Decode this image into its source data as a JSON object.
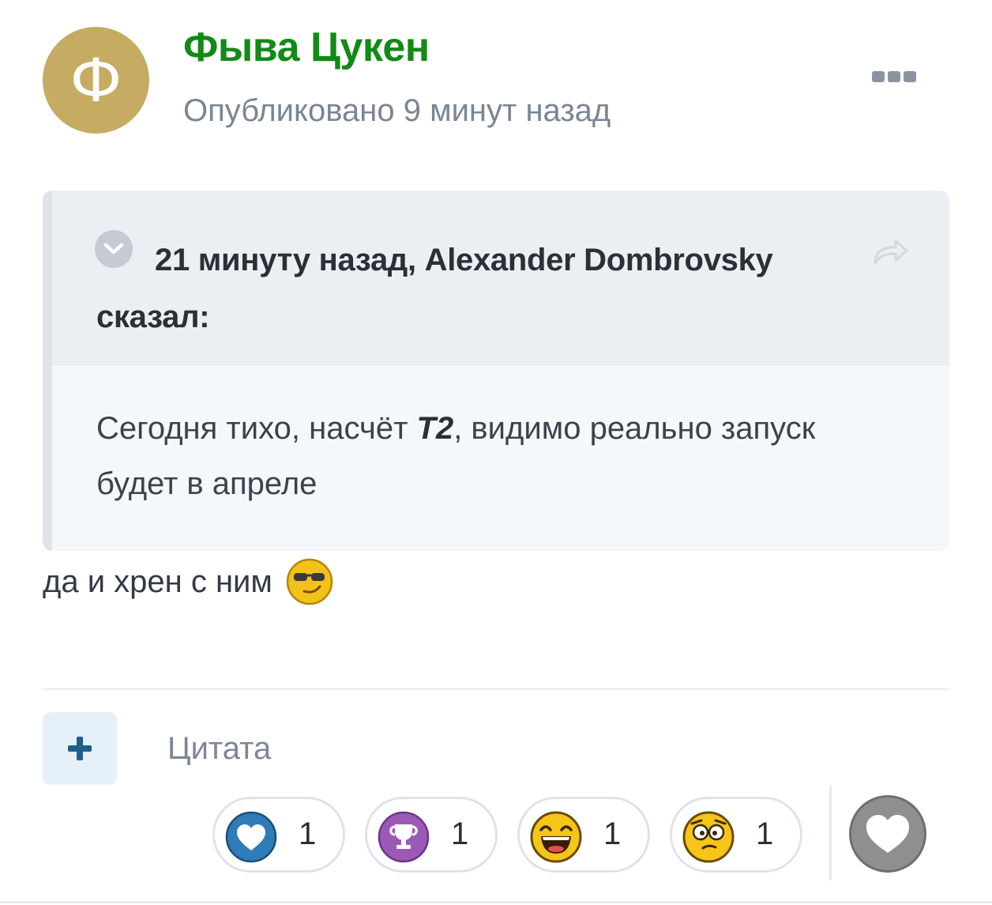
{
  "post": {
    "avatar_letter": "Ф",
    "author": "Фыва Цукен",
    "published": "Опубликовано 9 минут назад",
    "more_icon": "ellipsis-icon",
    "quote": {
      "citation": "21 минуту назад, Alexander Dombrovsky сказал:",
      "text_before": "Сегодня тихо, насчёт ",
      "text_em": "Т2",
      "text_after": ", видимо реально запуск будет в апреле"
    },
    "text": "да и хрен с ним",
    "text_emoji": "cool-sunglasses-emoji"
  },
  "actions": {
    "plus_icon": "plus-icon",
    "quote_label": "Цитата"
  },
  "reactions": [
    {
      "name": "like",
      "icon": "heart-icon",
      "color": "#2e7cb8",
      "count": "1"
    },
    {
      "name": "thanks",
      "icon": "trophy-icon",
      "color": "#9b59b6",
      "count": "1"
    },
    {
      "name": "haha",
      "icon": "laughing-emoji",
      "color": "#f5c518",
      "count": "1"
    },
    {
      "name": "confused",
      "icon": "confused-emoji",
      "color": "#f5c518",
      "count": "1"
    }
  ],
  "react_button_icon": "heart-icon",
  "colors": {
    "author": "#128a16",
    "avatar_bg": "#c6ab62",
    "muted": "#7a8594"
  }
}
